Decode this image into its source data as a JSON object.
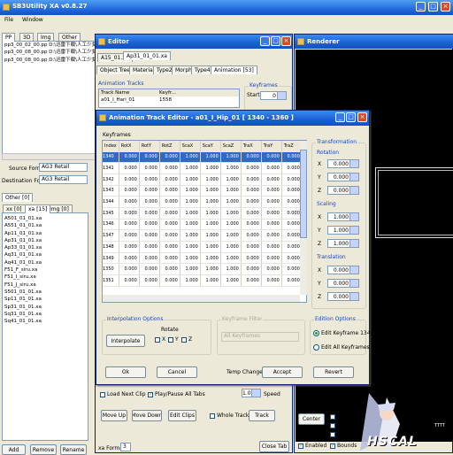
{
  "main": {
    "title": "SB3Utility XA v0.8.27",
    "menu": [
      "File",
      "Window"
    ]
  },
  "left": {
    "tabs": [
      "PP",
      "3D",
      "Img",
      "Other"
    ],
    "files": [
      "pp3_00_02_00.pp D:\\迅雷下载\\人工少女",
      "pp3_00_08_00.pp D:\\迅雷下载\\人工少女",
      "pp3_00_08_00.pp D:\\迅雷下载\\人工少女"
    ],
    "source_format_label": "Source Format",
    "source_format": "AG3 Retail",
    "dest_format_label": "Destination Format",
    "dest_format": "AG3 Retail",
    "other_tab": "Other [0]",
    "subtabs": [
      "xx [0]",
      "xa [15]",
      "Img [0]"
    ],
    "xa_files": [
      "A501_01_01.xa",
      "A551_01_01.xa",
      "Ap11_01_01.xa",
      "Ap31_01_01.xa",
      "Ap33_01_01.xa",
      "Aq31_01_01.xa",
      "Aq41_01_01.xa",
      "F51_F_siru.xa",
      "F51_I_siru.xa",
      "F51_J_siru.xa",
      "S501_01_01.xa",
      "Sp11_01_01.xa",
      "Sp31_01_01.xa",
      "Sq31_01_01.xa",
      "Sq41_01_01.xa"
    ],
    "buttons": [
      "Add",
      "Remove",
      "Rename"
    ]
  },
  "editor": {
    "title": "Editor",
    "tabs": [
      "A15_01.xa",
      "Ap31_01_01.xa"
    ],
    "subtabs": [
      "Object Tree",
      "Material",
      "Type2",
      "Morph",
      "Type4",
      "Animation [53]"
    ],
    "anim_tracks_label": "Animation Tracks",
    "cols": [
      "Track Name",
      "Keyfr..."
    ],
    "row": {
      "name": "a01_I_Hari_01",
      "value": "1558"
    },
    "keyframes_label": "Keyframes",
    "start_label": "Start",
    "start": "0",
    "load_next_clip": "Load Next Clip",
    "play_pause": "Play/Pause All Tabs",
    "speed": "1.0",
    "speed_label": "Speed",
    "move_up": "Move Up",
    "move_down": "Move Down",
    "edit_clips": "Edit Clips",
    "whole_track": "Whole Track",
    "track_btn": "Track",
    "format_label": "xa Format",
    "format": "3",
    "close_tab": "Close Tab"
  },
  "renderer": {
    "title": "Renderer",
    "center": "Center",
    "checks": [
      "Wireframe",
      "Normals",
      "Bones",
      "Enabled",
      "Bounds"
    ],
    "enabled": "Enabled",
    "logo": "HSCAL",
    "tooltip": "TTTT"
  },
  "dialog": {
    "title": "Animation Track Editor - a01_I_Hip_01 [ 1340 - 1360 ]",
    "keyframes_label": "Keyframes",
    "columns": [
      "Index",
      "RotX",
      "RotY",
      "RotZ",
      "ScaX",
      "ScaY",
      "ScaZ",
      "TraX",
      "TraY",
      "TraZ"
    ],
    "rows": [
      [
        "1340",
        "0.000",
        "0.000",
        "0.000",
        "1.000",
        "1.000",
        "1.000",
        "0.000",
        "0.000",
        "0.000"
      ],
      [
        "1341",
        "0.000",
        "0.000",
        "0.000",
        "1.000",
        "1.000",
        "1.000",
        "0.000",
        "0.000",
        "0.000"
      ],
      [
        "1342",
        "0.000",
        "0.000",
        "0.000",
        "1.000",
        "1.000",
        "1.000",
        "0.000",
        "0.000",
        "0.000"
      ],
      [
        "1343",
        "0.000",
        "0.000",
        "0.000",
        "1.000",
        "1.000",
        "1.000",
        "0.000",
        "0.000",
        "0.000"
      ],
      [
        "1344",
        "0.000",
        "0.000",
        "0.000",
        "1.000",
        "1.000",
        "1.000",
        "0.000",
        "0.000",
        "0.000"
      ],
      [
        "1345",
        "0.000",
        "0.000",
        "0.000",
        "1.000",
        "1.000",
        "1.000",
        "0.000",
        "0.000",
        "0.000"
      ],
      [
        "1346",
        "0.000",
        "0.000",
        "0.000",
        "1.000",
        "1.000",
        "1.000",
        "0.000",
        "0.000",
        "0.000"
      ],
      [
        "1347",
        "0.000",
        "0.000",
        "0.000",
        "1.000",
        "1.000",
        "1.000",
        "0.000",
        "0.000",
        "0.000"
      ],
      [
        "1348",
        "0.000",
        "0.000",
        "0.000",
        "1.000",
        "1.000",
        "1.000",
        "0.000",
        "0.000",
        "0.000"
      ],
      [
        "1349",
        "0.000",
        "0.000",
        "0.000",
        "1.000",
        "1.000",
        "1.000",
        "0.000",
        "0.000",
        "0.000"
      ],
      [
        "1350",
        "0.000",
        "0.000",
        "0.000",
        "1.000",
        "1.000",
        "1.000",
        "0.000",
        "0.000",
        "0.000"
      ],
      [
        "1351",
        "0.000",
        "0.000",
        "0.000",
        "1.000",
        "1.000",
        "1.000",
        "0.000",
        "0.000",
        "0.000"
      ]
    ],
    "selected_row": 0,
    "transformation_label": "Transformation",
    "rotation_label": "Rotation",
    "scaling_label": "Scaling",
    "translation_label": "Translation",
    "axes": [
      "X",
      "Y",
      "Z"
    ],
    "rotation": [
      "0.000",
      "0.000",
      "0.000"
    ],
    "scaling": [
      "1.000",
      "1.000",
      "1.000"
    ],
    "translation": [
      "0.000",
      "0.000",
      "0.000"
    ],
    "interp_label": "Interpolation Options",
    "interpolate": "Interpolate",
    "rotate_label": "Rotate",
    "rotate_axes": [
      "X",
      "Y",
      "Z"
    ],
    "filter_label": "Keyframe Filter",
    "filter_value": "All Keyframes",
    "edition_label": "Edition Options",
    "edit_kf": "Edit Keyframe 1340",
    "edit_all": "Edit All Keyframes",
    "ok": "Ok",
    "cancel": "Cancel",
    "temp_changes": "Temp Changes:",
    "accept": "Accept",
    "revert": "Revert"
  },
  "colors": {
    "titlebar": "#1a5fd4",
    "selection": "#316ac5",
    "window_bg": "#ece9d8",
    "label_blue": "#1c47b7"
  }
}
